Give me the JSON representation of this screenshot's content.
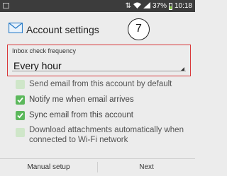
{
  "status_bar": {
    "battery_percent_label": "37%",
    "time": "10:18"
  },
  "header": {
    "title": "Account settings",
    "step_number": "7"
  },
  "inbox_check": {
    "label": "Inbox check frequency",
    "value": "Every hour"
  },
  "options": [
    {
      "label": "Send email from this account by default",
      "checked": false
    },
    {
      "label": "Notify me when email arrives",
      "checked": true
    },
    {
      "label": "Sync email from this account",
      "checked": true
    },
    {
      "label": "Download attachments automatically when connected to Wi-Fi network",
      "checked": false
    }
  ],
  "buttons": {
    "manual_setup": "Manual setup",
    "next": "Next"
  },
  "colors": {
    "accent_green": "#5cb85c",
    "highlight_red": "#d9383a",
    "envelope_blue": "#2f7fc8"
  }
}
